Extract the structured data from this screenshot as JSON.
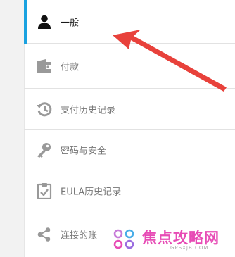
{
  "menu": {
    "items": [
      {
        "label": "一般",
        "icon": "user-icon",
        "active": true
      },
      {
        "label": "付款",
        "icon": "wallet-icon"
      },
      {
        "label": "支付历史记录",
        "icon": "history-icon"
      },
      {
        "label": "密码与安全",
        "icon": "key-icon"
      },
      {
        "label": "EULA历史记录",
        "icon": "clipboard-check-icon"
      },
      {
        "label": "连接的账",
        "icon": "share-icon"
      }
    ]
  },
  "watermark": {
    "brand": "焦点攻略网",
    "domain": "GPSXJB.COM"
  },
  "colors": {
    "accent": "#1aa2e0",
    "arrow": "#e8413b",
    "watermark": "#e74bb5"
  }
}
